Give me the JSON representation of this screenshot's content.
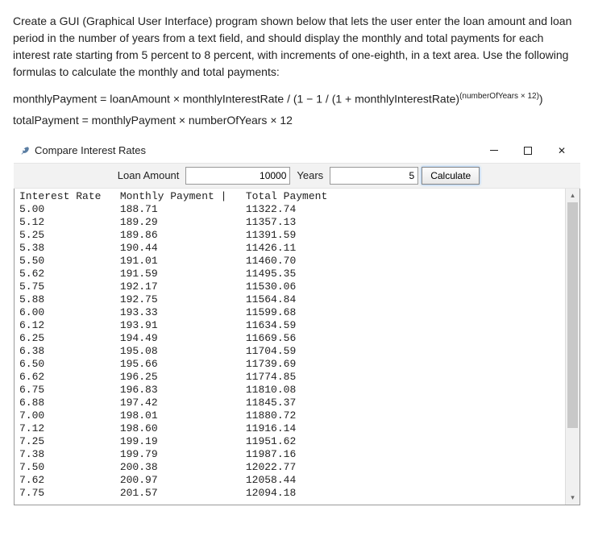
{
  "instructions": {
    "p1": "Create a GUI (Graphical User Interface) program shown below that lets the user enter the loan amount and loan period in the number of years from a text field, and should display the monthly and total payments for each interest rate starting from 5 percent to 8 percent, with increments of one-eighth, in a text area. Use the following formulas to calculate the monthly and total payments:",
    "f1_pre": "monthlyPayment = loanAmount × monthlyInterestRate / (1  −  1 / (1 + monthlyInterestRate)",
    "f1_exp": "(numberOfYears × 12)",
    "f1_post": ")",
    "f2": "totalPayment = monthlyPayment × numberOfYears × 12"
  },
  "window": {
    "title": "Compare Interest Rates"
  },
  "form": {
    "loan_label": "Loan Amount",
    "loan_value": "10000",
    "years_label": "Years",
    "years_value": "5",
    "calc_label": "Calculate"
  },
  "output": {
    "header": {
      "rate": "Interest Rate",
      "monthly": "Monthly Payment",
      "total": "Total Payment"
    }
  },
  "chart_data": {
    "type": "table",
    "title": "Loan payments by interest rate",
    "columns": [
      "Interest Rate",
      "Monthly Payment",
      "Total Payment"
    ],
    "rows": [
      [
        "5.00",
        "188.71",
        "11322.74"
      ],
      [
        "5.12",
        "189.29",
        "11357.13"
      ],
      [
        "5.25",
        "189.86",
        "11391.59"
      ],
      [
        "5.38",
        "190.44",
        "11426.11"
      ],
      [
        "5.50",
        "191.01",
        "11460.70"
      ],
      [
        "5.62",
        "191.59",
        "11495.35"
      ],
      [
        "5.75",
        "192.17",
        "11530.06"
      ],
      [
        "5.88",
        "192.75",
        "11564.84"
      ],
      [
        "6.00",
        "193.33",
        "11599.68"
      ],
      [
        "6.12",
        "193.91",
        "11634.59"
      ],
      [
        "6.25",
        "194.49",
        "11669.56"
      ],
      [
        "6.38",
        "195.08",
        "11704.59"
      ],
      [
        "6.50",
        "195.66",
        "11739.69"
      ],
      [
        "6.62",
        "196.25",
        "11774.85"
      ],
      [
        "6.75",
        "196.83",
        "11810.08"
      ],
      [
        "6.88",
        "197.42",
        "11845.37"
      ],
      [
        "7.00",
        "198.01",
        "11880.72"
      ],
      [
        "7.12",
        "198.60",
        "11916.14"
      ],
      [
        "7.25",
        "199.19",
        "11951.62"
      ],
      [
        "7.38",
        "199.79",
        "11987.16"
      ],
      [
        "7.50",
        "200.38",
        "12022.77"
      ],
      [
        "7.62",
        "200.97",
        "12058.44"
      ],
      [
        "7.75",
        "201.57",
        "12094.18"
      ]
    ]
  }
}
